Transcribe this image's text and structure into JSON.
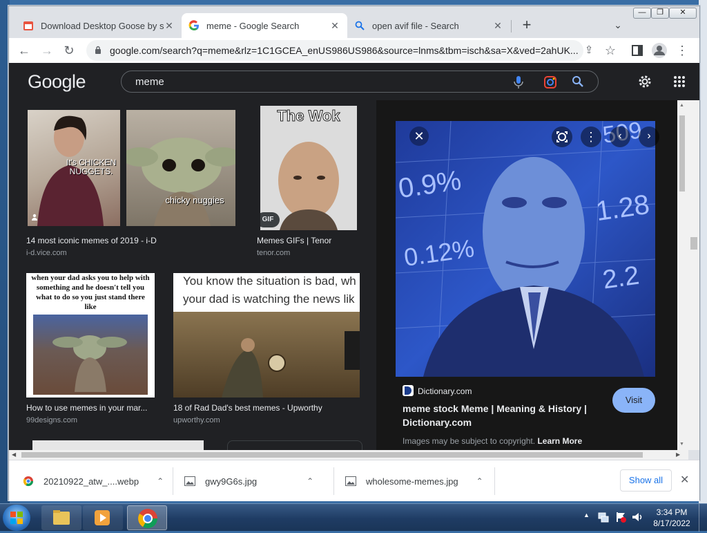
{
  "tabs": [
    {
      "title": "Download Desktop Goose by san",
      "icon": "calendar-icon"
    },
    {
      "title": "meme - Google Search",
      "icon": "google-icon"
    },
    {
      "title": "open avif file - Search",
      "icon": "search-icon"
    }
  ],
  "address": {
    "url": "google.com/search?q=meme&rlz=1C1GCEA_enUS986US986&source=lnms&tbm=isch&sa=X&ved=2ahUK..."
  },
  "google": {
    "logo": "Google",
    "query": "meme"
  },
  "results": [
    {
      "title": "14 most iconic memes of 2019 - i-D",
      "source": "i-d.vice.com",
      "caption1": "It's CHICKEN NUGGETS.",
      "caption2": "chicky nuggies"
    },
    {
      "title": "Memes GIFs | Tenor",
      "source": "tenor.com",
      "caption": "The Wok",
      "badge": "GIF"
    },
    {
      "title": "How to use memes in your mar...",
      "source": "99designs.com",
      "caption": "when your dad asks you to help with something and he doesn't tell you what to do so you just stand there like"
    },
    {
      "title": "18 of Rad Dad's best memes - Upworthy",
      "source": "upworthy.com",
      "caption": "You know the situation is bad, wh your dad is watching the news lik"
    }
  ],
  "preview": {
    "site": "Dictionary.com",
    "title": "meme stock Meme | Meaning & History | Dictionary.com",
    "visit": "Visit",
    "copyright": "Images may be subject to copyright.",
    "learn_more": "Learn More",
    "img_texts": [
      "0.9%",
      "0.12%",
      "1.28",
      "2.2",
      "509"
    ]
  },
  "downloads": [
    {
      "name": "20210922_atw_....webp",
      "icon": "chrome-icon"
    },
    {
      "name": "gwy9G6s.jpg",
      "icon": "image-icon"
    },
    {
      "name": "wholesome-memes.jpg",
      "icon": "image-icon"
    }
  ],
  "download_bar": {
    "show_all": "Show all"
  },
  "clock": {
    "time": "3:34 PM",
    "date": "8/17/2022"
  },
  "colors": {
    "accent": "#8ab4f8",
    "dark_bg": "#202124"
  }
}
